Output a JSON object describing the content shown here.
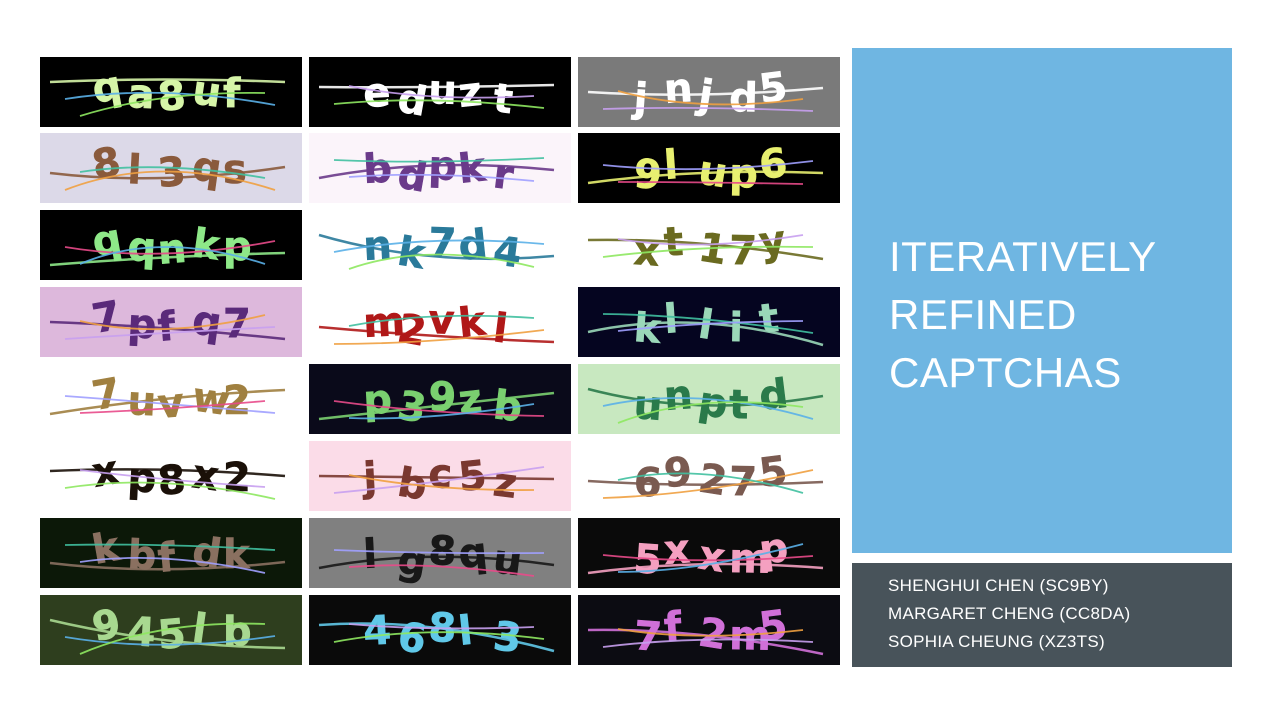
{
  "slide": {
    "title_lines": [
      "ITERATIVELY",
      "REFINED",
      "CAPTCHAS"
    ],
    "authors": [
      "SHENGHUI CHEN (SC9BY)",
      "MARGARET CHENG (CC8DA)",
      "SOPHIA CHEUNG (XZ3TS)"
    ],
    "colors": {
      "title_panel": "#6fb6e2",
      "authors_panel": "#48535a",
      "text": "#ffffff"
    }
  },
  "captchas": [
    {
      "text": "qa8uf",
      "bg": "#000000",
      "fg": "#d6f5a8"
    },
    {
      "text": "eduzt",
      "bg": "#000000",
      "fg": "#ffffff"
    },
    {
      "text": "jnjd5",
      "bg": "#7a7a7a",
      "fg": "#ffffff"
    },
    {
      "text": "8l3qs",
      "bg": "#dcd9e8",
      "fg": "#8a5a3c"
    },
    {
      "text": "bdpkr",
      "bg": "#fbf4fa",
      "fg": "#6a3a8a"
    },
    {
      "text": "9lup6",
      "bg": "#000000",
      "fg": "#e8f070"
    },
    {
      "text": "qqnkp",
      "bg": "#000000",
      "fg": "#8ee888"
    },
    {
      "text": "nk7d4",
      "bg": "#ffffff",
      "fg": "#2a7a9a"
    },
    {
      "text": "xt17y",
      "bg": "#ffffff",
      "fg": "#6a6a20"
    },
    {
      "text": "7pfq7",
      "bg": "#ddb8dc",
      "fg": "#5a2a7a"
    },
    {
      "text": "m2vkl",
      "bg": "#ffffff",
      "fg": "#b01818"
    },
    {
      "text": "kllit",
      "bg": "#050520",
      "fg": "#9ad8b8"
    },
    {
      "text": "7uvw2",
      "bg": "#ffffff",
      "fg": "#a08040"
    },
    {
      "text": "p39zb",
      "bg": "#0a0a1a",
      "fg": "#7ad070"
    },
    {
      "text": "unptd",
      "bg": "#c8e8c0",
      "fg": "#2a7a4a"
    },
    {
      "text": "xp8x2",
      "bg": "#ffffff",
      "fg": "#1a1008"
    },
    {
      "text": "jbc5z",
      "bg": "#fbdce8",
      "fg": "#7a3830"
    },
    {
      "text": "69275",
      "bg": "#ffffff",
      "fg": "#7a5a50"
    },
    {
      "text": "kbfdk",
      "bg": "#0c1808",
      "fg": "#8a7060"
    },
    {
      "text": "lg8qu",
      "bg": "#808080",
      "fg": "#181818"
    },
    {
      "text": "5xxmp",
      "bg": "#0a0a0a",
      "fg": "#f4a0c0"
    },
    {
      "text": "945lb",
      "bg": "#2e3e1e",
      "fg": "#a8d890"
    },
    {
      "text": "468l3",
      "bg": "#0a0a0a",
      "fg": "#60c8e8"
    },
    {
      "text": "7f2m5",
      "bg": "#0c0c12",
      "fg": "#d070d8"
    }
  ]
}
